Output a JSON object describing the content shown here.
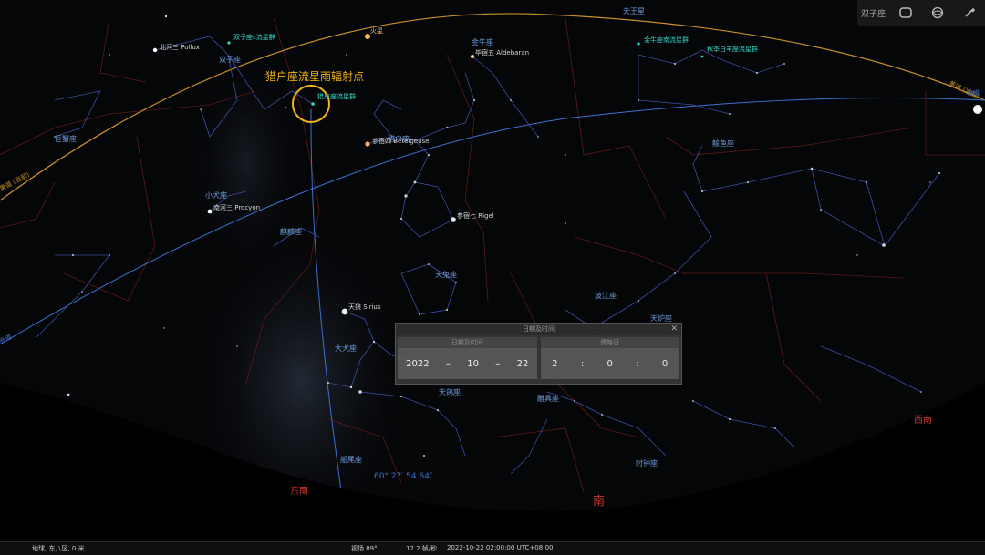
{
  "toolbar": {
    "title": "双子座",
    "icons": [
      "view-icon",
      "atmosphere-icon",
      "settings-icon"
    ]
  },
  "annotations": {
    "radiant_label": "猎户座流星雨辐射点",
    "altitude": "60° 27′ 54.64″"
  },
  "constellations": [
    {
      "label": "天王星"
    },
    {
      "label": "火星"
    },
    {
      "label": "金牛座"
    },
    {
      "label": "双子座"
    },
    {
      "label": "巨蟹座"
    },
    {
      "label": "小犬座"
    },
    {
      "label": "猎户座"
    },
    {
      "label": "麒麟座"
    },
    {
      "label": "鲸鱼座"
    },
    {
      "label": "天兔座"
    },
    {
      "label": "波江座"
    },
    {
      "label": "天炉座"
    },
    {
      "label": "大犬座"
    },
    {
      "label": "天鸽座"
    },
    {
      "label": "雕具座"
    },
    {
      "label": "船尾座"
    },
    {
      "label": "时钟座"
    }
  ],
  "stars": [
    {
      "label": "北河三 Pollux"
    },
    {
      "label": "毕宿五 Aldebaran"
    },
    {
      "label": "参宿四 Betelgeuse"
    },
    {
      "label": "参宿七 Rigel"
    },
    {
      "label": "南河三 Procyon"
    },
    {
      "label": "天狼 Sirius"
    }
  ],
  "showers": [
    {
      "label": "双子座ε流星群"
    },
    {
      "label": "猎户座流星群"
    },
    {
      "label": "金牛座南流星群"
    },
    {
      "label": "秋季白羊座流星群"
    }
  ],
  "lines": {
    "ecliptic_left": "黄道 (当前)",
    "ecliptic_right": "黄道 (当前)",
    "equator_left": "赤道",
    "equator_right": "赤道"
  },
  "cardinals": {
    "southeast": "东南",
    "south": "南",
    "southwest": "西南"
  },
  "dialog": {
    "title": "日期及时间",
    "date_header": "日期及时间",
    "julian_header": "儒略日",
    "year": "2022",
    "sep1": "–",
    "month": "10",
    "sep2": "–",
    "day": "22",
    "hour": "2",
    "colon1": ":",
    "minute": "0",
    "colon2": ":",
    "second": "0"
  },
  "status_bar": {
    "location": "地球, 东八区, 0 米",
    "fov": "视场 89°",
    "fps": "12.2 帧/秒",
    "datetime": "2022-10-22 02:00:00 UTC+08:00"
  }
}
